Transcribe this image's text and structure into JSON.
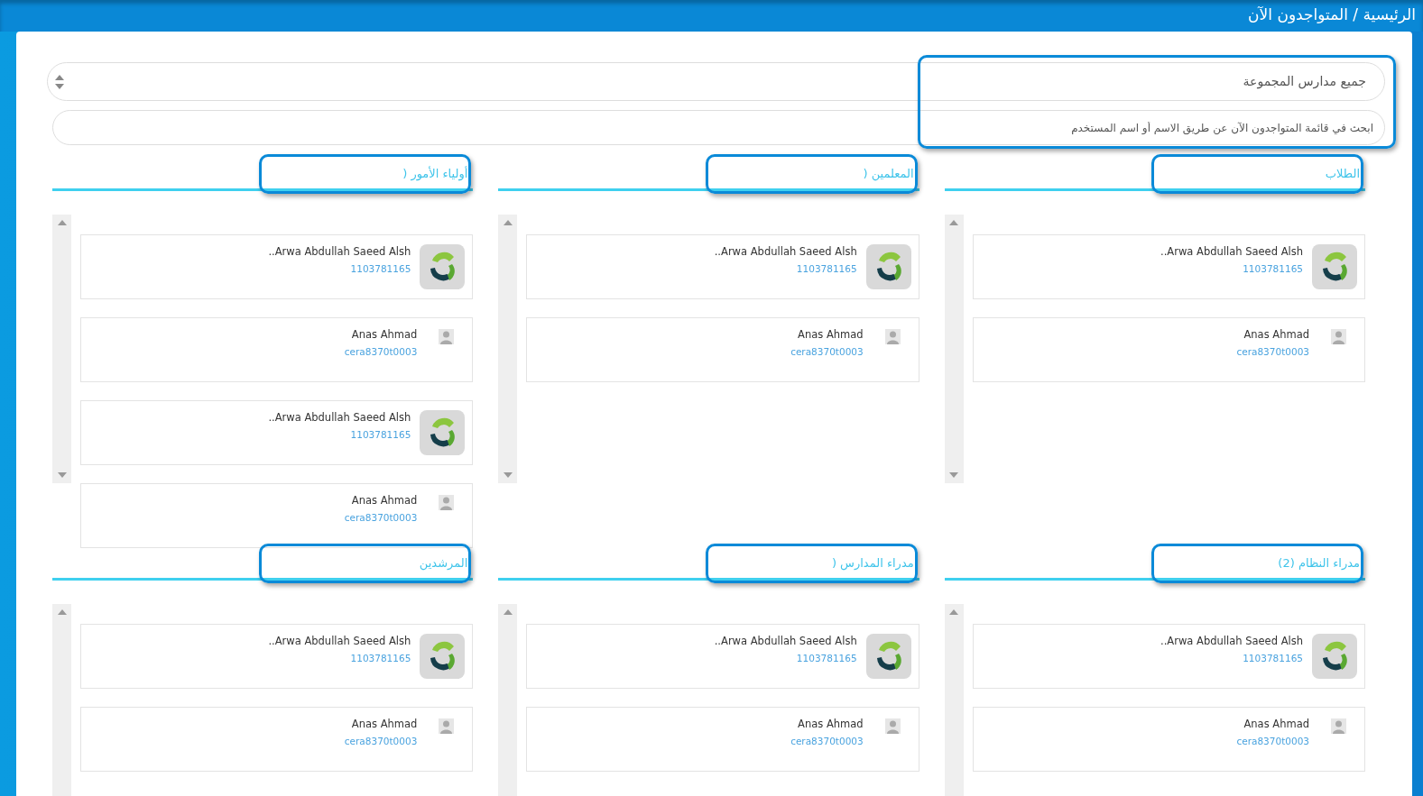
{
  "breadcrumb": "الرئيسية / المتواجدون الآن",
  "filters_highlighted": true,
  "school_select": {
    "value": "جميع مدارس المجموعة"
  },
  "search": {
    "placeholder": "ابحث في قائمة المتواجدون الآن عن طريق الاسم أو اسم المستخدم"
  },
  "panels": {
    "students": {
      "title": "الطلاب",
      "highlighted": true,
      "users": [
        {
          "name": "..Arwa Abdullah Saeed Alsh",
          "username": "1103781165",
          "kind": "logo"
        },
        {
          "name": "Anas Ahmad",
          "username": "cera8370t0003",
          "kind": "silhouette"
        }
      ]
    },
    "teachers": {
      "title": "المعلمين (",
      "highlighted": true,
      "users": [
        {
          "name": "..Arwa Abdullah Saeed Alsh",
          "username": "1103781165",
          "kind": "logo"
        },
        {
          "name": "Anas Ahmad",
          "username": "cera8370t0003",
          "kind": "silhouette"
        }
      ]
    },
    "parents": {
      "title": "أولياء الأمور (",
      "highlighted": true,
      "users": [
        {
          "name": "..Arwa Abdullah Saeed Alsh",
          "username": "1103781165",
          "kind": "logo"
        },
        {
          "name": "Anas Ahmad",
          "username": "cera8370t0003",
          "kind": "silhouette"
        },
        {
          "name": "..Arwa Abdullah Saeed Alsh",
          "username": "1103781165",
          "kind": "logo"
        },
        {
          "name": "Anas Ahmad",
          "username": "cera8370t0003",
          "kind": "silhouette"
        }
      ]
    },
    "system_admins": {
      "title": "مدراء النظام (2)",
      "highlighted": true,
      "users": [
        {
          "name": "..Arwa Abdullah Saeed Alsh",
          "username": "1103781165",
          "kind": "logo"
        },
        {
          "name": "Anas Ahmad",
          "username": "cera8370t0003",
          "kind": "silhouette"
        }
      ]
    },
    "school_admins": {
      "title": "مدراء المدارس (",
      "highlighted": true,
      "users": [
        {
          "name": "..Arwa Abdullah Saeed Alsh",
          "username": "1103781165",
          "kind": "logo"
        },
        {
          "name": "Anas Ahmad",
          "username": "cera8370t0003",
          "kind": "silhouette"
        }
      ]
    },
    "counselors": {
      "title": "المرشدين",
      "highlighted": true,
      "users": [
        {
          "name": "..Arwa Abdullah Saeed Alsh",
          "username": "1103781165",
          "kind": "logo"
        },
        {
          "name": "Anas Ahmad",
          "username": "cera8370t0003",
          "kind": "silhouette"
        }
      ]
    }
  }
}
